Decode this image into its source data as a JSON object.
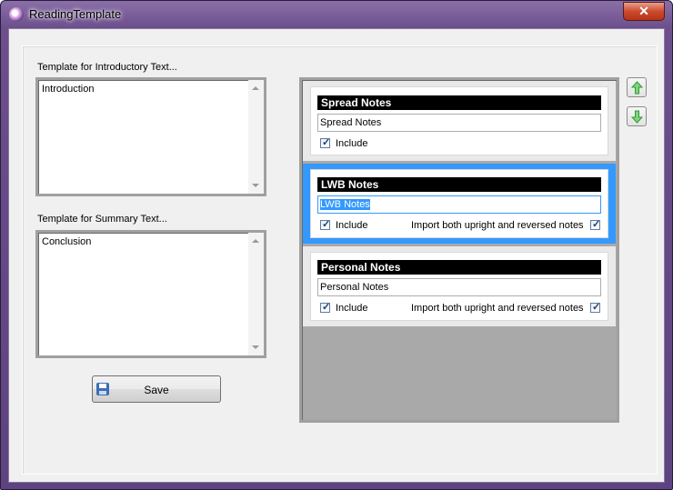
{
  "window": {
    "title": "ReadingTemplate",
    "close_glyph": "✕"
  },
  "intro": {
    "label": "Template for Introductory Text...",
    "value": "Introduction"
  },
  "summary": {
    "label": "Template for Summary Text...",
    "value": "Conclusion"
  },
  "save_button": {
    "label": "Save",
    "icon": "floppy-disk-icon"
  },
  "move_up": {
    "icon": "arrow-up-icon",
    "color": "#2e9e2e"
  },
  "move_down": {
    "icon": "arrow-down-icon",
    "color": "#2e9e2e"
  },
  "selection_color": "#3399ff",
  "note_sections": [
    {
      "header": "Spread Notes",
      "name_value": "Spread Notes",
      "include_label": "Include",
      "include_checked": true,
      "selected": false
    },
    {
      "header": "LWB Notes",
      "name_value": "LWB Notes",
      "include_label": "Include",
      "include_checked": true,
      "import_label": "Import both upright and reversed notes",
      "import_checked": true,
      "selected": true
    },
    {
      "header": "Personal Notes",
      "name_value": "Personal Notes",
      "include_label": "Include",
      "include_checked": true,
      "import_label": "Import both upright and reversed notes",
      "import_checked": true,
      "selected": false
    }
  ]
}
